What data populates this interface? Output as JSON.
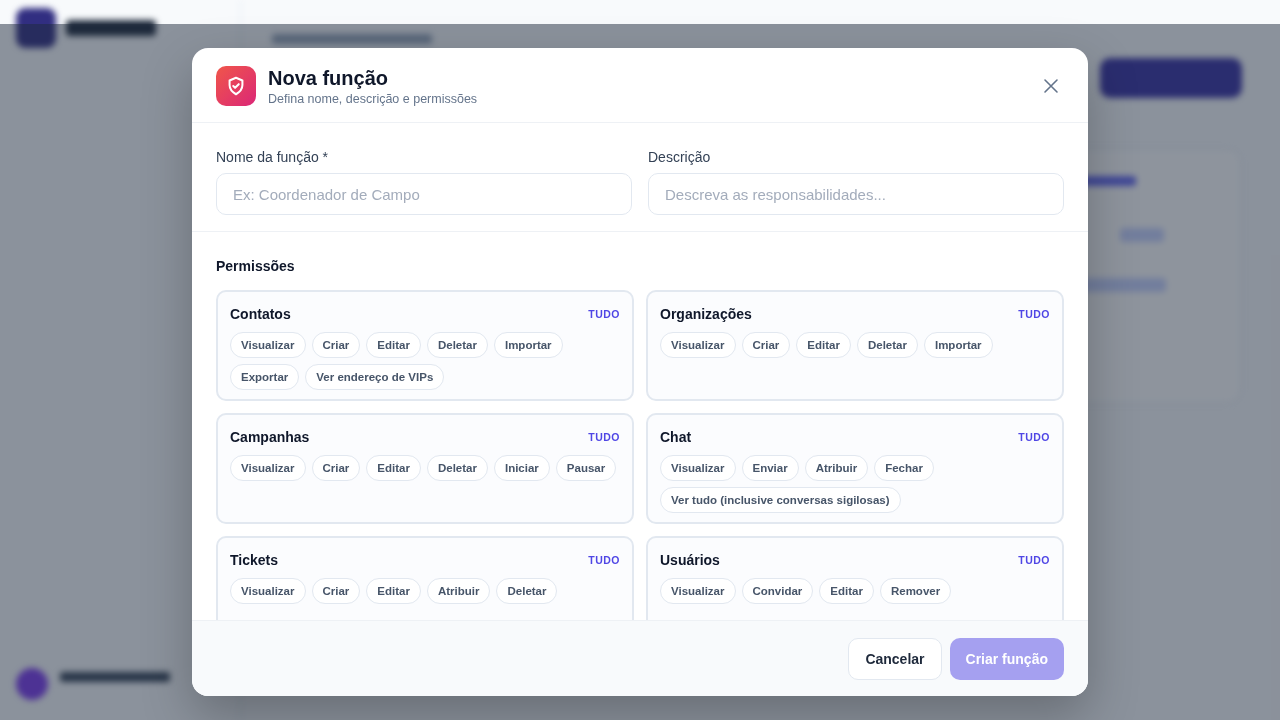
{
  "dialog": {
    "title": "Nova função",
    "subtitle": "Defina nome, descrição e permissões",
    "fields": [
      {
        "label": "Nome da função *",
        "placeholder": "Ex: Coordenador de Campo"
      },
      {
        "label": "Descrição",
        "placeholder": "Descreva as responsabilidades..."
      }
    ],
    "permissions_title": "Permissões",
    "groups": [
      {
        "name": "Contatos",
        "all_label": "TUDO",
        "actions": [
          "Visualizar",
          "Criar",
          "Editar",
          "Deletar",
          "Importar",
          "Exportar",
          "Ver endereço de VIPs"
        ]
      },
      {
        "name": "Organizações",
        "all_label": "TUDO",
        "actions": [
          "Visualizar",
          "Criar",
          "Editar",
          "Deletar",
          "Importar"
        ]
      },
      {
        "name": "Campanhas",
        "all_label": "TUDO",
        "actions": [
          "Visualizar",
          "Criar",
          "Editar",
          "Deletar",
          "Iniciar",
          "Pausar"
        ]
      },
      {
        "name": "Chat",
        "all_label": "TUDO",
        "actions": [
          "Visualizar",
          "Enviar",
          "Atribuir",
          "Fechar",
          "Ver tudo (inclusive conversas sigilosas)"
        ]
      },
      {
        "name": "Tickets",
        "all_label": "TUDO",
        "actions": [
          "Visualizar",
          "Criar",
          "Editar",
          "Atribuir",
          "Deletar"
        ]
      },
      {
        "name": "Usuários",
        "all_label": "TUDO",
        "actions": [
          "Visualizar",
          "Convidar",
          "Editar",
          "Remover"
        ]
      }
    ],
    "buttons": [
      {
        "label": "Cancelar",
        "kind": "secondary"
      },
      {
        "label": "Criar função",
        "kind": "primary"
      }
    ]
  }
}
